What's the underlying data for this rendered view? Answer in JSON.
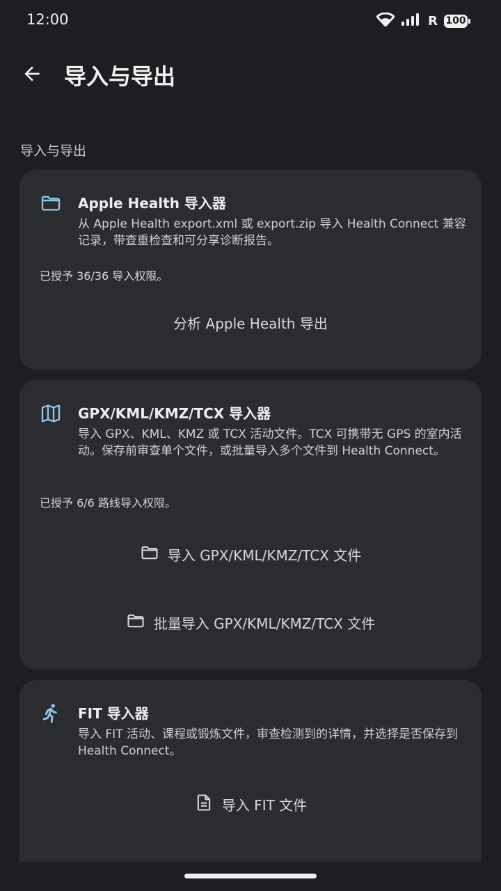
{
  "status_bar": {
    "time": "12:00",
    "battery": "100",
    "icons": [
      "wifi-icon",
      "signal-icon",
      "roaming-r-icon",
      "battery-icon"
    ]
  },
  "app_bar": {
    "title": "导入与导出",
    "back_icon": "arrow-back-icon"
  },
  "section": {
    "header": "导入与导出"
  },
  "cards": [
    {
      "icon": "folder-icon",
      "title": "Apple Health 导入器",
      "description": "从 Apple Health export.xml 或 export.zip 导入 Health Connect 兼容记录，带查重检查和可分享诊断报告。",
      "permission": "已授予 36/36 导入权限。",
      "action": "分析 Apple Health 导出"
    },
    {
      "icon": "map-icon",
      "title": "GPX/KML/KMZ/TCX 导入器",
      "description": "导入 GPX、KML、KMZ 或 TCX 活动文件。TCX 可携带无 GPS 的室内活动。保存前审查单个文件，或批量导入多个文件到 Health Connect。",
      "permission": "已授予 6/6 路线导入权限。",
      "action_single": "导入 GPX/KML/KMZ/TCX 文件",
      "action_batch": "批量导入 GPX/KML/KMZ/TCX 文件"
    },
    {
      "icon": "running-icon",
      "title": "FIT 导入器",
      "description": "导入 FIT 活动、课程或锻炼文件，审查检测到的详情，并选择是否保存到 Health Connect。",
      "action": "导入 FIT 文件"
    }
  ],
  "colors": {
    "background": "#1d1e21",
    "card": "#2b2c30",
    "accent_icon": "#8fc3e6"
  }
}
